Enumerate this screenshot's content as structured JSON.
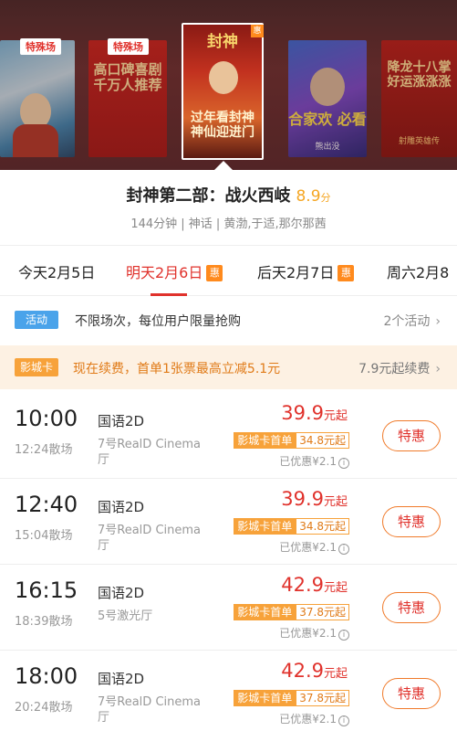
{
  "carousel": {
    "posters": [
      {
        "text": "",
        "badge": "特殊场"
      },
      {
        "text": "高口碑喜剧 千万人推荐",
        "badge": "特殊场"
      },
      {
        "text": "过年看封神 神仙迎进门",
        "corner": "惠",
        "title": "封神"
      },
      {
        "text": "合家欢 必看",
        "sub": "熊出没"
      },
      {
        "text": "降龙十八掌 好运涨涨涨",
        "sub": "射雕英雄传"
      }
    ]
  },
  "movie": {
    "title": "封神第二部：战火西岐",
    "score": "8.9",
    "score_unit": "分",
    "meta": "144分钟 | 神话 | 黄渤,于适,那尔那茜"
  },
  "dates": [
    {
      "label": "今天2月5日"
    },
    {
      "label": "明天2月6日",
      "hui": "惠",
      "active": true
    },
    {
      "label": "后天2月7日",
      "hui": "惠"
    },
    {
      "label": "周六2月8"
    }
  ],
  "activity": {
    "badge": "活动",
    "text": "不限场次，每位用户限量抢购",
    "right": "2个活动",
    "chevron": "chevron-right-icon"
  },
  "card_promo": {
    "badge": "影城卡",
    "text": "现在续费，首单1张票最高立减5.1元",
    "right": "7.9元起续费",
    "chevron": "chevron-right-icon"
  },
  "shows": [
    {
      "start": "10:00",
      "end": "12:24散场",
      "lang": "国语2D",
      "hall": "7号RealD Cinema厅",
      "price": "39.9",
      "price_unit": "元起",
      "card_label": "影城卡首单",
      "card_price": "34.8元起",
      "discount": "已优惠¥2.1",
      "button": "特惠"
    },
    {
      "start": "12:40",
      "end": "15:04散场",
      "lang": "国语2D",
      "hall": "7号RealD Cinema厅",
      "price": "39.9",
      "price_unit": "元起",
      "card_label": "影城卡首单",
      "card_price": "34.8元起",
      "discount": "已优惠¥2.1",
      "button": "特惠"
    },
    {
      "start": "16:15",
      "end": "18:39散场",
      "lang": "国语2D",
      "hall": "5号激光厅",
      "price": "42.9",
      "price_unit": "元起",
      "card_label": "影城卡首单",
      "card_price": "37.8元起",
      "discount": "已优惠¥2.1",
      "button": "特惠"
    },
    {
      "start": "18:00",
      "end": "20:24散场",
      "lang": "国语2D",
      "hall": "7号RealD Cinema厅",
      "price": "42.9",
      "price_unit": "元起",
      "card_label": "影城卡首单",
      "card_price": "37.8元起",
      "discount": "已优惠¥2.1",
      "button": "特惠"
    }
  ],
  "colors": {
    "accent": "#e0322c",
    "orange": "#f7a23a",
    "score": "#f5a623",
    "blue": "#4aa3ea"
  }
}
